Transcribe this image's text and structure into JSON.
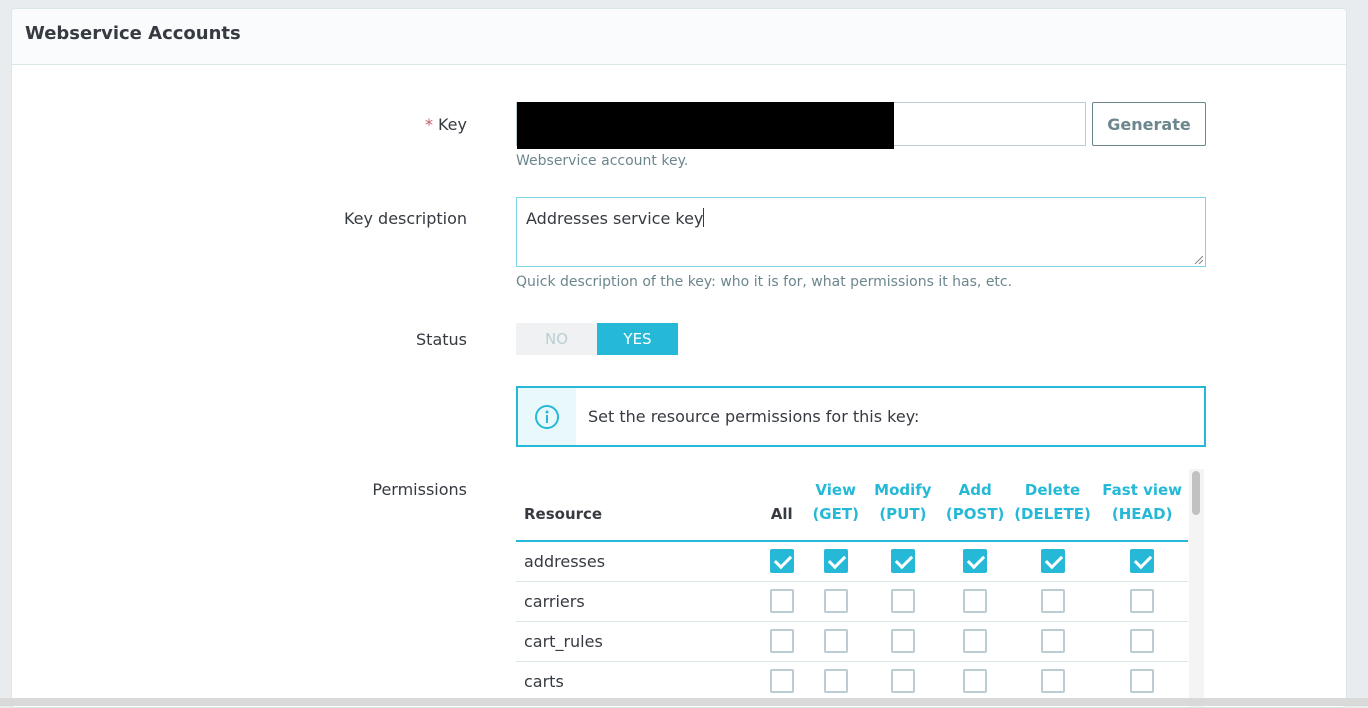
{
  "panel": {
    "title": "Webservice Accounts"
  },
  "key_field": {
    "required_mark": "*",
    "label": "Key",
    "value": "",
    "help": "Webservice account key.",
    "generate_label": "Generate"
  },
  "description_field": {
    "label": "Key description",
    "value": "Addresses service key",
    "help": "Quick description of the key: who it is for, what permissions it has, etc."
  },
  "status_field": {
    "label": "Status",
    "off_label": "NO",
    "on_label": "YES",
    "selected": "YES"
  },
  "alert": {
    "icon": "info-circle-icon",
    "text": "Set the resource permissions for this key:"
  },
  "permissions": {
    "label": "Permissions",
    "columns": {
      "resource": "Resource",
      "all": "All",
      "view": [
        "View",
        "(GET)"
      ],
      "modify": [
        "Modify",
        "(PUT)"
      ],
      "add": [
        "Add",
        "(POST)"
      ],
      "delete": [
        "Delete",
        "(DELETE)"
      ],
      "fast_view": [
        "Fast view",
        "(HEAD)"
      ]
    },
    "rows": [
      {
        "name": "addresses",
        "checked": [
          true,
          true,
          true,
          true,
          true,
          true
        ]
      },
      {
        "name": "carriers",
        "checked": [
          false,
          false,
          false,
          false,
          false,
          false
        ]
      },
      {
        "name": "cart_rules",
        "checked": [
          false,
          false,
          false,
          false,
          false,
          false
        ]
      },
      {
        "name": "carts",
        "checked": [
          false,
          false,
          false,
          false,
          false,
          false
        ]
      }
    ]
  },
  "colors": {
    "accent": "#25b9d7",
    "required": "#c05c67",
    "muted": "#6c868e"
  }
}
